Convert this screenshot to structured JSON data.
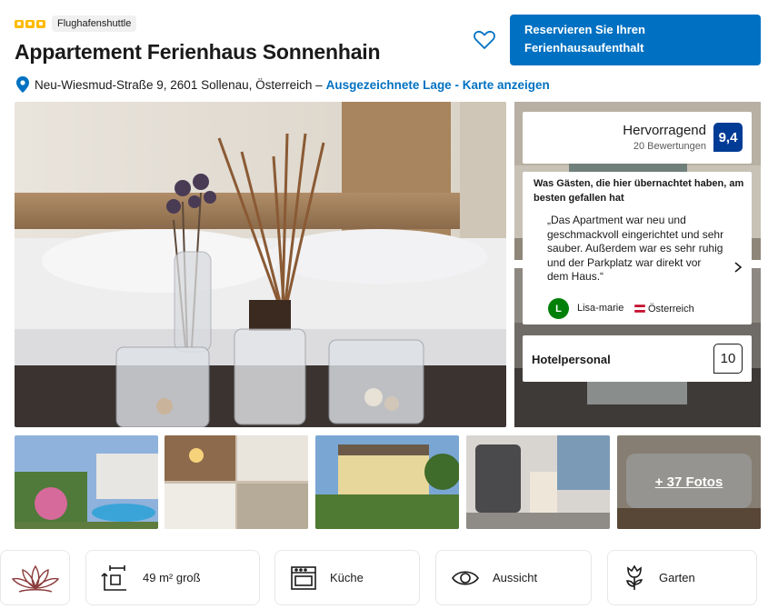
{
  "header": {
    "star_count": 3,
    "star_color": "#febb02",
    "badge": "Flughafenshuttle",
    "title": "Appartement Ferienhaus Sonnenhain",
    "favorite_icon": "heart-icon",
    "reserve_button": "Reservieren Sie Ihren Ferienhausaufenthalt",
    "accent_color": "#0071c2"
  },
  "location": {
    "icon": "map-pin-icon",
    "address": "Neu-Wiesmud-Straße 9, 2601 Sollenau, Österreich –",
    "link": "Ausgezeichnete Lage - Karte anzeigen"
  },
  "rating": {
    "label": "Hervorragend",
    "count": "20 Bewertungen",
    "score": "9,4",
    "badge_color": "#003b95"
  },
  "review": {
    "heading": "Was Gästen, die hier übernachtet haben, am besten gefallen hat",
    "quote": "„Das Apartment war neu und geschmackvoll eingerichtet und sehr sauber. Außerdem war es sehr ruhig und der Parkplatz war direkt vor dem Haus.“",
    "avatar_initial": "L",
    "reviewer": "Lisa-marie",
    "country": "Österreich"
  },
  "staff": {
    "label": "Hotelpersonal",
    "score": "10"
  },
  "gallery": {
    "more_photos": "+ 37 Fotos"
  },
  "facilities": [
    {
      "icon": "floor-area-icon",
      "label": "49 m² groß"
    },
    {
      "icon": "kitchen-icon",
      "label": "Küche"
    },
    {
      "icon": "eye-icon",
      "label": "Aussicht"
    },
    {
      "icon": "garden-flower-icon",
      "label": "Garten"
    }
  ],
  "sustainability_icon": "lotus-icon"
}
